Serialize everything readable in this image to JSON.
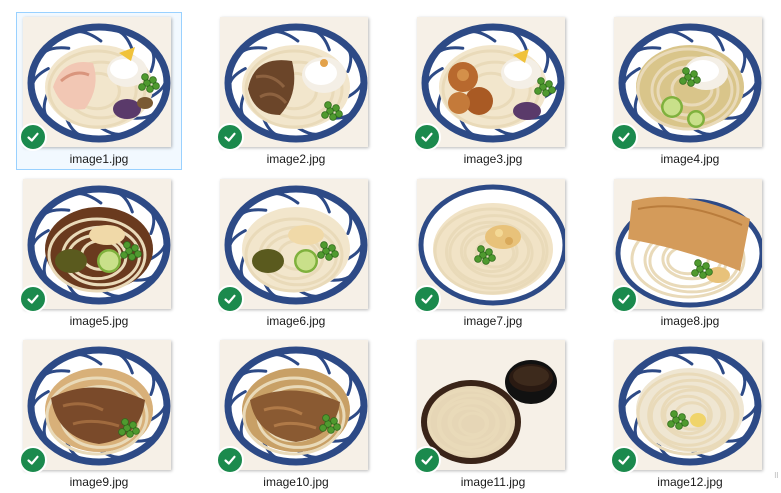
{
  "files": [
    {
      "name": "image1.jpg",
      "selected": true,
      "sync_status": "synced",
      "status_icon": "check-circle-icon",
      "dish": "chicken-shabu-tempura-udon"
    },
    {
      "name": "image2.jpg",
      "selected": false,
      "sync_status": "synced",
      "status_icon": "check-circle-icon",
      "dish": "beef-grated-radish-udon"
    },
    {
      "name": "image3.jpg",
      "selected": false,
      "sync_status": "synced",
      "status_icon": "check-circle-icon",
      "dish": "karaage-udon"
    },
    {
      "name": "image4.jpg",
      "selected": false,
      "sync_status": "synced",
      "status_icon": "check-circle-icon",
      "dish": "sudachi-oroshi-udon"
    },
    {
      "name": "image5.jpg",
      "selected": false,
      "sync_status": "synced",
      "status_icon": "check-circle-icon",
      "dish": "bukkake-udon-with-lime"
    },
    {
      "name": "image6.jpg",
      "selected": false,
      "sync_status": "synced",
      "status_icon": "check-circle-icon",
      "dish": "bukkake-udon-with-lime-light"
    },
    {
      "name": "image7.jpg",
      "selected": false,
      "sync_status": "synced",
      "status_icon": "check-circle-icon",
      "dish": "tempura-flakes-udon"
    },
    {
      "name": "image8.jpg",
      "selected": false,
      "sync_status": "synced",
      "status_icon": "check-circle-icon",
      "dish": "kitsune-udon"
    },
    {
      "name": "image9.jpg",
      "selected": false,
      "sync_status": "synced",
      "status_icon": "check-circle-icon",
      "dish": "beef-udon"
    },
    {
      "name": "image10.jpg",
      "selected": false,
      "sync_status": "synced",
      "status_icon": "check-circle-icon",
      "dish": "beef-udon-broth"
    },
    {
      "name": "image11.jpg",
      "selected": false,
      "sync_status": "synced",
      "status_icon": "check-circle-icon",
      "dish": "zaru-udon-with-dipping-sauce"
    },
    {
      "name": "image12.jpg",
      "selected": false,
      "sync_status": "synced",
      "status_icon": "check-circle-icon",
      "dish": "kamaage-udon-with-ginger"
    }
  ],
  "colors": {
    "check_green": "#1b8a4d",
    "selection_border": "#99d1ff",
    "bowl_blue": "#2d4a86",
    "udon": "#f3e7cf"
  }
}
